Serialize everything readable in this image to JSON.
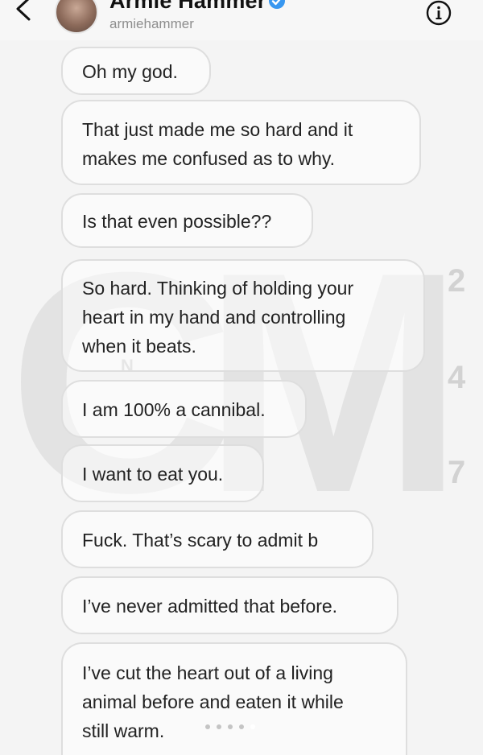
{
  "header": {
    "contact_name": "Armie Hammer",
    "username": "armiehammer",
    "icons": {
      "back": "chevron-left-icon",
      "verified": "verified-badge-icon",
      "info": "info-icon"
    },
    "verified_color": "#3897f0"
  },
  "watermark": {
    "letters": "CM",
    "small_text": "N",
    "digits": [
      "2",
      "4",
      "7"
    ],
    "color": "#cfcfcf"
  },
  "messages": [
    {
      "text": "Oh my god."
    },
    {
      "text": "That just made me so hard and it\nmakes me confused as to why."
    },
    {
      "text": "Is that even possible??"
    },
    {
      "text": "So hard. Thinking of holding your\nheart in my hand and controlling\nwhen it beats."
    },
    {
      "text": "I am 100% a cannibal."
    },
    {
      "text": "I want to eat you."
    },
    {
      "text": "Fuck. That’s scary to admit b"
    },
    {
      "text": "I’ve never admitted that before."
    },
    {
      "text": "I’ve cut the heart out of a living\nanimal before and eaten it while\nstill warm."
    }
  ],
  "pager": {
    "count": 5,
    "active_index": 4
  }
}
